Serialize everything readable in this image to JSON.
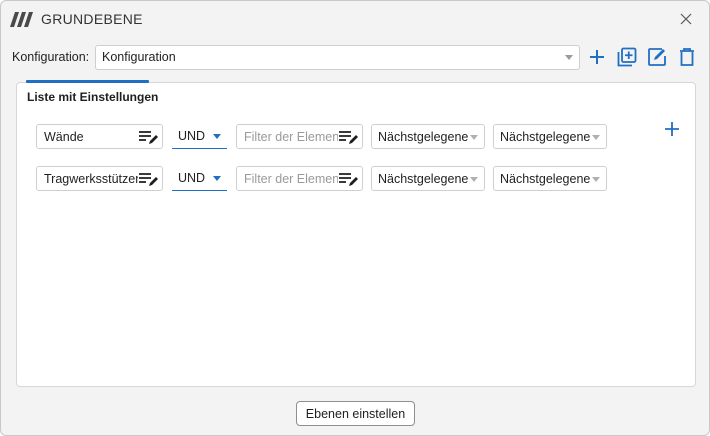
{
  "window": {
    "title": "GRUNDEBENE"
  },
  "config": {
    "label": "Konfiguration:",
    "selected": "Konfiguration"
  },
  "toolbar": {
    "icons": [
      "plus-icon",
      "add-box-icon",
      "edit-icon",
      "trash-icon"
    ]
  },
  "panel": {
    "title": "Liste mit Einstellungen",
    "rows": [
      {
        "category": "Wände",
        "operator": "UND",
        "filter_placeholder": "Filter der Elemente",
        "option1": "Nächstgelegene",
        "option2": "Nächstgelegene"
      },
      {
        "category": "Tragwerksstützen",
        "operator": "UND",
        "filter_placeholder": "Filter der Elemente",
        "option1": "Nächstgelegene",
        "option2": "Nächstgelegene"
      }
    ]
  },
  "footer": {
    "button_label": "Ebenen einstellen"
  },
  "colors": {
    "accent": "#1f6fc5",
    "text": "#1f1f1f",
    "placeholder": "#9a9a9a"
  }
}
